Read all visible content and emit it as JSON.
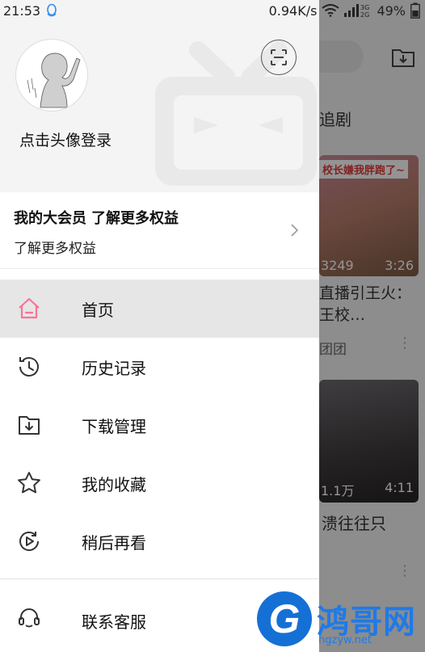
{
  "status_bar": {
    "time": "21:53",
    "speed": "0.94K/s",
    "network_top": "3G",
    "network_bottom": "2G",
    "battery": "49%"
  },
  "drawer": {
    "login_prompt": "点击头像登录",
    "vip": {
      "title": "我的大会员",
      "title_sub": "了解更多权益",
      "description": "了解更多权益"
    },
    "menu": [
      {
        "label": "首页",
        "icon": "home-icon",
        "active": true
      },
      {
        "label": "历史记录",
        "icon": "history-icon",
        "active": false
      },
      {
        "label": "下载管理",
        "icon": "download-folder-icon",
        "active": false
      },
      {
        "label": "我的收藏",
        "icon": "star-icon",
        "active": false
      },
      {
        "label": "稍后再看",
        "icon": "watch-later-icon",
        "active": false
      }
    ],
    "service_label": "联系客服",
    "accent_color": "#fb7299"
  },
  "background": {
    "tab_partial": "追剧",
    "card1": {
      "banner": "校长嫌我胖跑了~",
      "views": "3249",
      "duration": "3:26",
      "title": "直播引王火：王校…",
      "uploader": "团团"
    },
    "card2": {
      "views": "1.1万",
      "duration": "4:11",
      "title": "溃往往只"
    }
  },
  "watermark": {
    "logo_letter": "G",
    "text": "鸿哥网",
    "url": "hgzyw.net"
  }
}
